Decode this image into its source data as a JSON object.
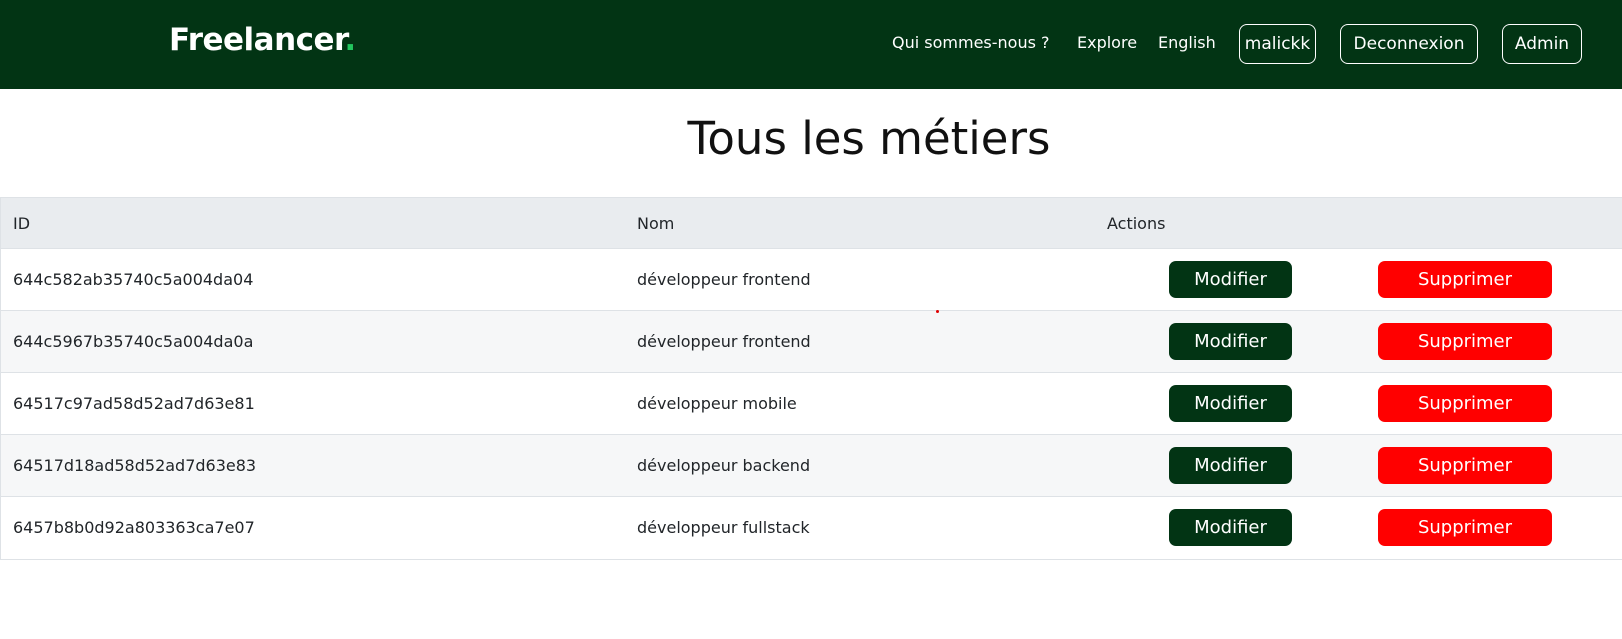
{
  "header": {
    "brand": "Freelancer",
    "brand_dot": ".",
    "links": {
      "about": "Qui sommes-nous ?",
      "explore": "Explore",
      "language": "English"
    },
    "buttons": {
      "user": "malickk",
      "logout": "Deconnexion",
      "admin": "Admin"
    }
  },
  "page": {
    "title": "Tous les métiers"
  },
  "table": {
    "columns": {
      "id": "ID",
      "name": "Nom",
      "actions": "Actions"
    },
    "rows": [
      {
        "id": "644c582ab35740c5a004da04",
        "name": "développeur frontend",
        "edit": "Modifier",
        "delete": "Supprimer"
      },
      {
        "id": "644c5967b35740c5a004da0a",
        "name": "développeur frontend",
        "edit": "Modifier",
        "delete": "Supprimer"
      },
      {
        "id": "64517c97ad58d52ad7d63e81",
        "name": "développeur mobile",
        "edit": "Modifier",
        "delete": "Supprimer"
      },
      {
        "id": "64517d18ad58d52ad7d63e83",
        "name": "développeur backend",
        "edit": "Modifier",
        "delete": "Supprimer"
      },
      {
        "id": "6457b8b0d92a803363ca7e07",
        "name": "développeur fullstack",
        "edit": "Modifier",
        "delete": "Supprimer"
      }
    ]
  },
  "colors": {
    "header_bg": "#023414",
    "brand_dot": "#22c55e",
    "edit_button": "#023414",
    "delete_button": "#ff0000"
  }
}
